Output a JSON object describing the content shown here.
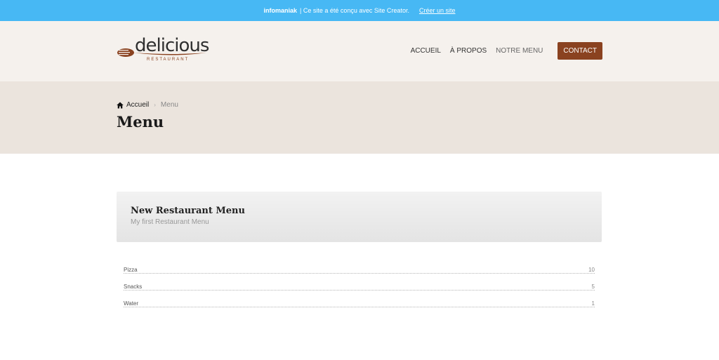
{
  "topbar": {
    "brand": "infomaniak",
    "message": "| Ce site a été conçu avec Site Creator.",
    "link": "Créer un site"
  },
  "logo": {
    "word": "delicious",
    "sub": "RESTAURANT"
  },
  "nav": {
    "items": [
      "ACCUEIL",
      "À PROPOS",
      "NOTRE MENU"
    ],
    "cta": "CONTACT"
  },
  "breadcrumb": {
    "home": "Accueil",
    "current": "Menu"
  },
  "page_title": "Menu",
  "menu": {
    "title": "New Restaurant Menu",
    "subtitle": "My first Restaurant Menu",
    "items": [
      {
        "name": "Pizza",
        "price": "10"
      },
      {
        "name": "Snacks",
        "price": "5"
      },
      {
        "name": "Water",
        "price": "1"
      }
    ]
  },
  "colors": {
    "topbar": "#47b8f4",
    "accent": "#8a4220",
    "header_bg": "#f5f1ed",
    "pagehead_bg": "#ebe4dd"
  }
}
